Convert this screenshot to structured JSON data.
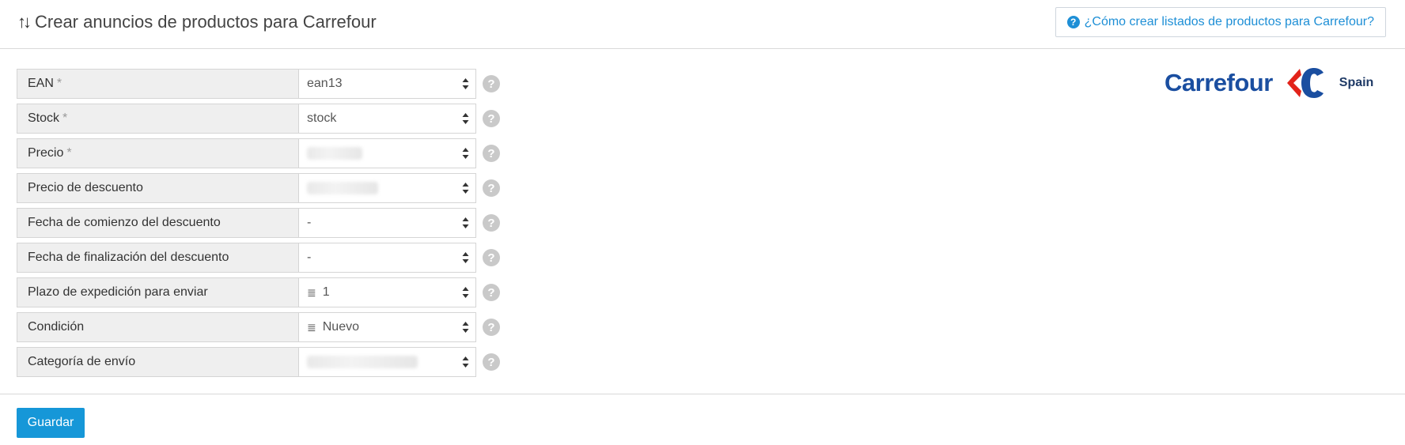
{
  "header": {
    "title": "Crear anuncios de productos para Carrefour",
    "help_link": "¿Cómo crear listados de productos para Carrefour?"
  },
  "logo": {
    "brand": "Carrefour",
    "region": "Spain"
  },
  "form": {
    "rows": [
      {
        "label": "EAN",
        "required": "*",
        "value": "ean13"
      },
      {
        "label": "Stock",
        "required": "*",
        "value": "stock"
      },
      {
        "label": "Precio",
        "required": "*",
        "value": ""
      },
      {
        "label": "Precio de descuento",
        "required": "",
        "value": ""
      },
      {
        "label": "Fecha de comienzo del descuento",
        "required": "",
        "value": "-"
      },
      {
        "label": "Fecha de finalización del descuento",
        "required": "",
        "value": "-"
      },
      {
        "label": "Plazo de expedición para enviar",
        "required": "",
        "value": "1"
      },
      {
        "label": "Condición",
        "required": "",
        "value": "Nuevo"
      },
      {
        "label": "Categoría de envío",
        "required": "",
        "value": ""
      }
    ]
  },
  "footer": {
    "save_label": "Guardar"
  },
  "colors": {
    "accent": "#1697d8",
    "link": "#1e8fd6",
    "brand_blue": "#1a4ea0",
    "brand_red": "#e2231a"
  }
}
